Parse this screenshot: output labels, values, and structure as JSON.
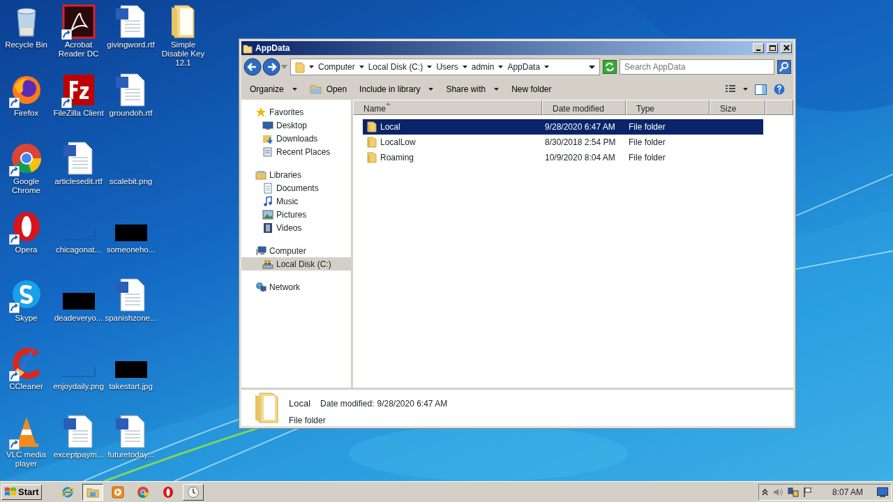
{
  "desktop_icons": [
    {
      "label": "Recycle Bin",
      "kind": "recycle",
      "shortcut": false
    },
    {
      "label": "Firefox",
      "kind": "firefox",
      "shortcut": true
    },
    {
      "label": "Google Chrome",
      "kind": "chrome",
      "shortcut": true
    },
    {
      "label": "Opera",
      "kind": "opera",
      "shortcut": true
    },
    {
      "label": "Skype",
      "kind": "skype",
      "shortcut": true
    },
    {
      "label": "CCleaner",
      "kind": "ccleaner",
      "shortcut": true
    },
    {
      "label": "VLC media player",
      "kind": "vlc",
      "shortcut": true
    },
    {
      "label": "Acrobat Reader DC",
      "kind": "pdf",
      "shortcut": true
    },
    {
      "label": "FileZilla Client",
      "kind": "filezilla",
      "shortcut": true
    },
    {
      "label": "articlesedit.rtf",
      "kind": "word",
      "shortcut": false
    },
    {
      "label": "chicagonat...",
      "kind": "blank-image",
      "shortcut": false
    },
    {
      "label": "deadeveryo...",
      "kind": "black-image",
      "shortcut": false
    },
    {
      "label": "enjoydaily.png",
      "kind": "blank-image",
      "shortcut": false
    },
    {
      "label": "exceptpaym...",
      "kind": "word",
      "shortcut": false
    },
    {
      "label": "givingword.rtf",
      "kind": "word",
      "shortcut": false
    },
    {
      "label": "groundoh.rtf",
      "kind": "word",
      "shortcut": false
    },
    {
      "label": "scalebit.png",
      "kind": "blank-image",
      "shortcut": false
    },
    {
      "label": "someoneho...",
      "kind": "black-image",
      "shortcut": false
    },
    {
      "label": "spanishzone...",
      "kind": "word",
      "shortcut": false
    },
    {
      "label": "takestart.jpg",
      "kind": "black-image",
      "shortcut": false
    },
    {
      "label": "futuretoday...",
      "kind": "word",
      "shortcut": false
    },
    {
      "label": "Simple Disable Key 12.1",
      "kind": "folder",
      "shortcut": false
    }
  ],
  "window": {
    "title": "AppData",
    "breadcrumb": [
      "Computer",
      "Local Disk (C:)",
      "Users",
      "admin",
      "AppData"
    ],
    "search": {
      "placeholder": "Search AppData"
    },
    "toolbar": [
      {
        "label": "Organize",
        "kind": "menu"
      },
      {
        "label": "Open",
        "kind": "open"
      },
      {
        "label": "Include in library",
        "kind": "menu"
      },
      {
        "label": "Share with",
        "kind": "menu"
      },
      {
        "label": "New folder",
        "kind": "plain"
      }
    ],
    "navigation": [
      {
        "label": "Favorites",
        "kind": "star",
        "selected": false,
        "children": [
          {
            "label": "Desktop",
            "kind": "desktop",
            "selected": false
          },
          {
            "label": "Downloads",
            "kind": "downloads",
            "selected": false
          },
          {
            "label": "Recent Places",
            "kind": "recent",
            "selected": false
          }
        ]
      },
      {
        "label": "Libraries",
        "kind": "libraries",
        "selected": false,
        "children": [
          {
            "label": "Documents",
            "kind": "documents",
            "selected": false
          },
          {
            "label": "Music",
            "kind": "music",
            "selected": false
          },
          {
            "label": "Pictures",
            "kind": "pictures",
            "selected": false
          },
          {
            "label": "Videos",
            "kind": "videos",
            "selected": false
          }
        ]
      },
      {
        "label": "Computer",
        "kind": "computer",
        "selected": false,
        "children": [
          {
            "label": "Local Disk (C:)",
            "kind": "disk",
            "selected": true
          }
        ]
      },
      {
        "label": "Network",
        "kind": "network",
        "selected": false
      }
    ],
    "columns": [
      {
        "label": "Name",
        "sorted": true
      },
      {
        "label": "Date modified",
        "sorted": false
      },
      {
        "label": "Type",
        "sorted": false
      },
      {
        "label": "Size",
        "sorted": false
      }
    ],
    "files": [
      {
        "name": "Local",
        "date_modified": "9/28/2020 6:47 AM",
        "type": "File folder",
        "selected": true
      },
      {
        "name": "LocalLow",
        "date_modified": "8/30/2018 2:54 PM",
        "type": "File folder",
        "selected": false
      },
      {
        "name": "Roaming",
        "date_modified": "10/9/2020 8:04 AM",
        "type": "File folder",
        "selected": false
      }
    ],
    "details": {
      "name": "Local",
      "date_label": "Date modified:",
      "date_modified": "9/28/2020 6:47 AM",
      "type": "File folder"
    }
  },
  "taskbar": {
    "start": "Start",
    "items": [
      {
        "kind": "ie",
        "running": false,
        "selected": false
      },
      {
        "kind": "explorer",
        "running": true,
        "selected": true
      },
      {
        "kind": "media",
        "running": false,
        "selected": false
      },
      {
        "kind": "chrome",
        "running": false,
        "selected": false
      },
      {
        "kind": "opera",
        "running": false,
        "selected": false
      },
      {
        "kind": "clock",
        "running": true,
        "selected": false
      }
    ],
    "time": "8:07 AM"
  }
}
